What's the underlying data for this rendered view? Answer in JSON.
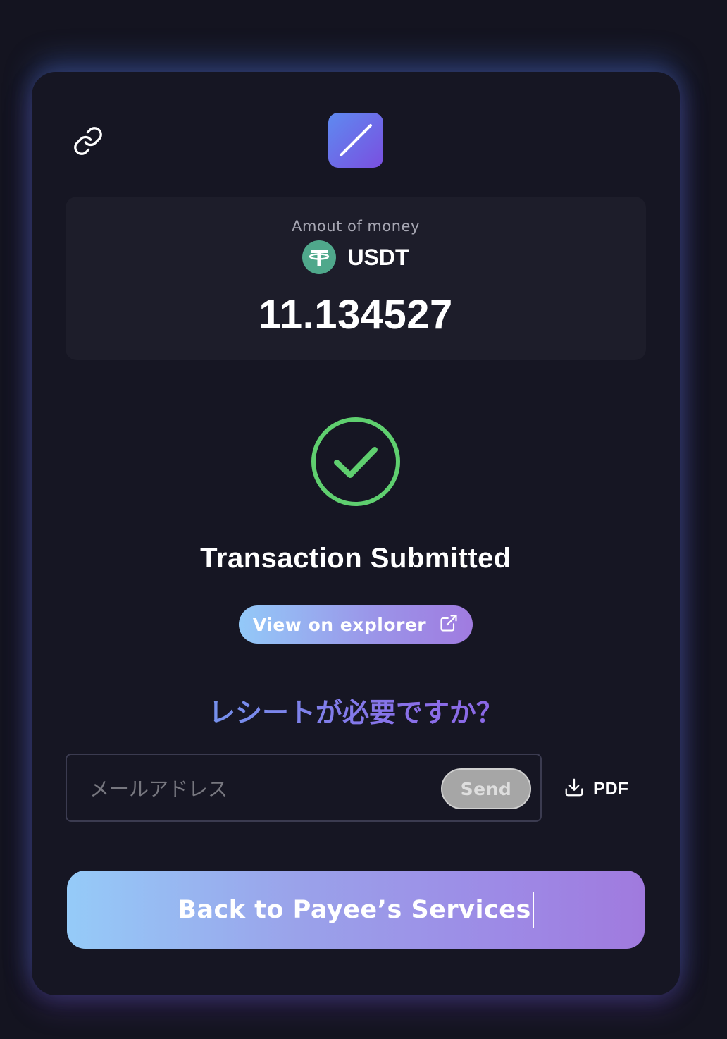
{
  "amount": {
    "label": "Amout of money",
    "currency": "USDT",
    "value": "11.134527"
  },
  "status": {
    "title": "Transaction Submitted",
    "explorer_label": "View on explorer"
  },
  "receipt": {
    "question": "レシートが必要ですか？",
    "email_placeholder": "メールアドレス",
    "send_label": "Send",
    "pdf_label": "PDF"
  },
  "back_button": {
    "label": "Back to Payee’s Services"
  },
  "colors": {
    "background": "#141420",
    "card": "#161623",
    "success": "#5fcf6f",
    "tether": "#4fa88b"
  },
  "icons": {
    "link": "link-icon",
    "logo": "slash-logo",
    "currency": "tether-icon",
    "success": "check-circle-icon",
    "explorer": "external-link-icon",
    "pdf": "download-icon"
  }
}
